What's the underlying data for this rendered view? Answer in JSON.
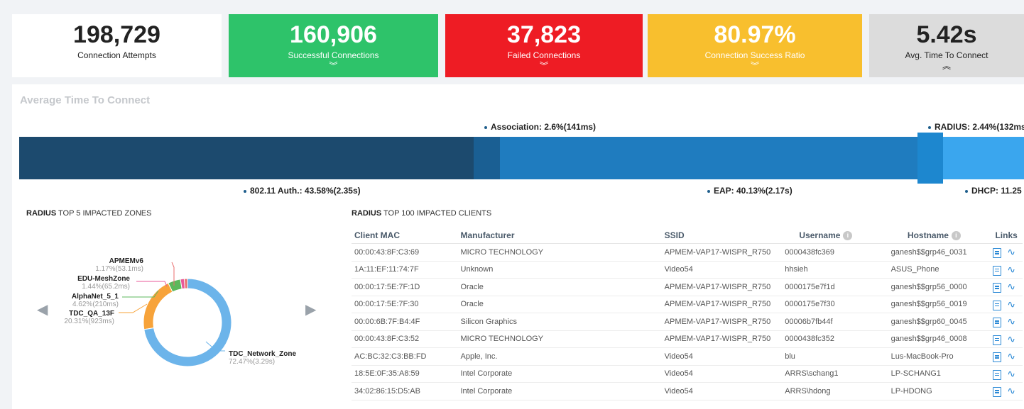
{
  "kpis": [
    {
      "value": "198,729",
      "label": "Connection Attempts",
      "chevron": ""
    },
    {
      "value": "160,906",
      "label": "Successful Connections",
      "chevron": "︾"
    },
    {
      "value": "37,823",
      "label": "Failed Connections",
      "chevron": "︾"
    },
    {
      "value": "80.97%",
      "label": "Connection Success Ratio",
      "chevron": "︾"
    },
    {
      "value": "5.42s",
      "label": "Avg. Time To Connect",
      "chevron": "︽"
    }
  ],
  "atc": {
    "title": "Average Time To Connect",
    "labels": {
      "association": "Association: 2.6%(141ms)",
      "radius": "RADIUS: 2.44%(132ms",
      "auth": "802.11 Auth.: 43.58%(2.35s)",
      "eap": "EAP: 40.13%(2.17s)",
      "dhcp": "DHCP: 11.25"
    },
    "colors": {
      "auth": "#1c4a6e",
      "association": "#1a5f93",
      "eap": "#1f7cbf",
      "radius": "#1d87cf",
      "dhcp": "#3aa6ee"
    }
  },
  "zones": {
    "title_bold": "RADIUS",
    "title_rest": " TOP 5 IMPACTED ZONES",
    "prev_icon": "left-arrow",
    "next_icon": "right-arrow",
    "items": [
      {
        "name": "APMEMv6",
        "pct": "1.17%(53.1ms)",
        "color": "#e86e6e",
        "share": 1.17
      },
      {
        "name": "EDU-MeshZone",
        "pct": "1.44%(65.2ms)",
        "color": "#e85a9a",
        "share": 1.44
      },
      {
        "name": "AlphaNet_5_1",
        "pct": "4.62%(210ms)",
        "color": "#5cb85c",
        "share": 4.62
      },
      {
        "name": "TDC_QA_13F",
        "pct": "20.31%(923ms)",
        "color": "#f7a33a",
        "share": 20.31
      },
      {
        "name": "TDC_Network_Zone",
        "pct": "72.47%(3.29s)",
        "color": "#6cb4ea",
        "share": 72.47
      }
    ]
  },
  "clients": {
    "title_bold": "RADIUS",
    "title_rest": " TOP 100 IMPACTED CLIENTS",
    "headers": {
      "mac": "Client MAC",
      "manufacturer": "Manufacturer",
      "ssid": "SSID",
      "username": "Username",
      "hostname": "Hostname",
      "links": "Links"
    },
    "rows": [
      {
        "mac": "00:00:43:8F:C3:69",
        "manufacturer": "MICRO TECHNOLOGY",
        "ssid": "APMEM-VAP17-WISPR_R750",
        "username": "0000438fc369",
        "hostname": "ganesh$$grp46_0031"
      },
      {
        "mac": "1A:11:EF:11:74:7F",
        "manufacturer": "Unknown",
        "ssid": "Video54",
        "username": "hhsieh",
        "hostname": "ASUS_Phone"
      },
      {
        "mac": "00:00:17:5E:7F:1D",
        "manufacturer": "Oracle",
        "ssid": "APMEM-VAP17-WISPR_R750",
        "username": "0000175e7f1d",
        "hostname": "ganesh$$grp56_0000"
      },
      {
        "mac": "00:00:17:5E:7F:30",
        "manufacturer": "Oracle",
        "ssid": "APMEM-VAP17-WISPR_R750",
        "username": "0000175e7f30",
        "hostname": "ganesh$$grp56_0019"
      },
      {
        "mac": "00:00:6B:7F:B4:4F",
        "manufacturer": "Silicon Graphics",
        "ssid": "APMEM-VAP17-WISPR_R750",
        "username": "00006b7fb44f",
        "hostname": "ganesh$$grp60_0045"
      },
      {
        "mac": "00:00:43:8F:C3:52",
        "manufacturer": "MICRO TECHNOLOGY",
        "ssid": "APMEM-VAP17-WISPR_R750",
        "username": "0000438fc352",
        "hostname": "ganesh$$grp46_0008"
      },
      {
        "mac": "AC:BC:32:C3:BB:FD",
        "manufacturer": "Apple, Inc.",
        "ssid": "Video54",
        "username": "blu",
        "hostname": "Lus-MacBook-Pro"
      },
      {
        "mac": "18:5E:0F:35:A8:59",
        "manufacturer": "Intel Corporate",
        "ssid": "Video54",
        "username": "ARRS\\schang1",
        "hostname": "LP-SCHANG1"
      },
      {
        "mac": "34:02:86:15:D5:AB",
        "manufacturer": "Intel Corporate",
        "ssid": "Video54",
        "username": "ARRS\\hdong",
        "hostname": "LP-HDONG"
      }
    ]
  }
}
